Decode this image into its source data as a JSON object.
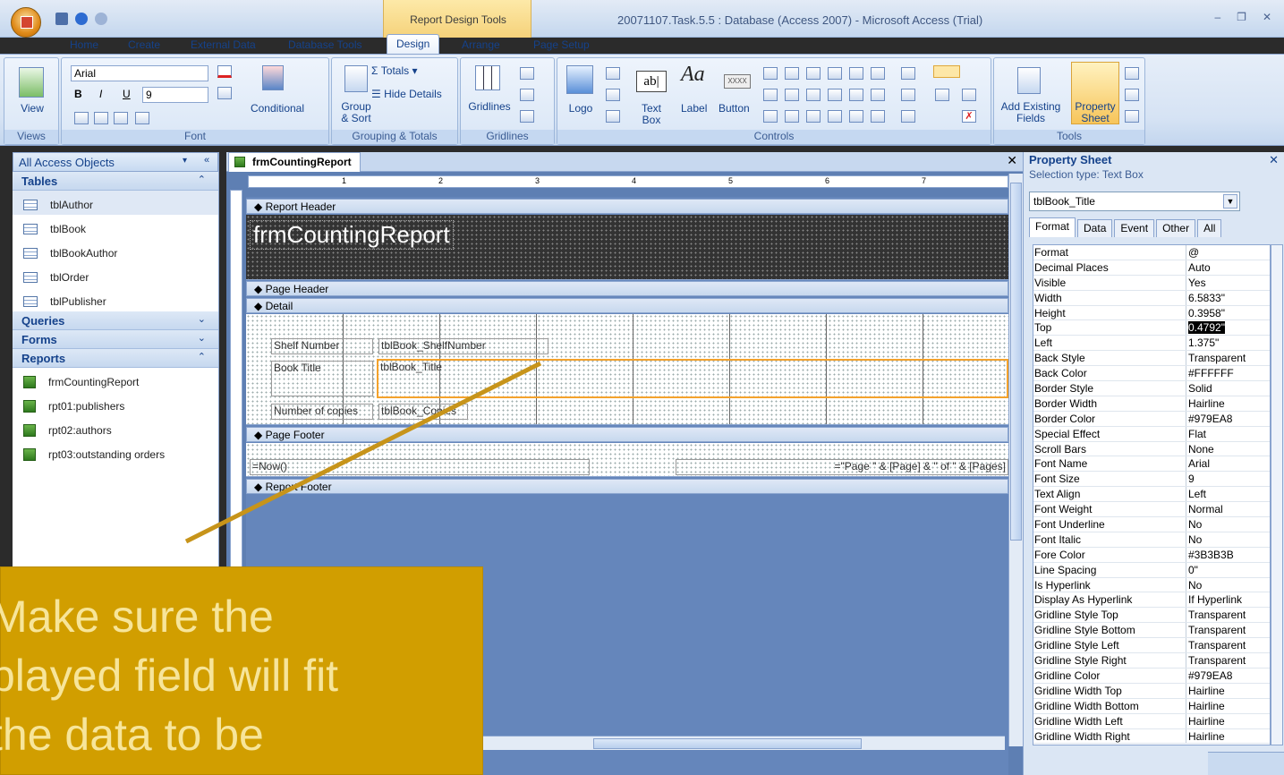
{
  "titlebar": {
    "context_label": "Report Design Tools",
    "window_title": "20071107.Task.5.5 : Database (Access 2007) - Microsoft Access (Trial)",
    "min": "–",
    "restore": "❐",
    "close": "✕"
  },
  "ribbon_tabs": [
    "Home",
    "Create",
    "External Data",
    "Database Tools",
    "Design",
    "Arrange",
    "Page Setup"
  ],
  "ribbon": {
    "views": {
      "view_label": "View",
      "group": "Views"
    },
    "font": {
      "font_name": "Arial",
      "font_size": "9",
      "conditional": "Conditional",
      "group": "Font",
      "bold": "B",
      "italic": "I",
      "underline": "U"
    },
    "grouping": {
      "totals": "Totals",
      "hide_details": "Hide Details",
      "group_sort": "Group\n& Sort",
      "group": "Grouping & Totals"
    },
    "gridlines": {
      "label": "Gridlines",
      "group": "Gridlines"
    },
    "controls": {
      "logo": "Logo",
      "text_box": "Text\nBox",
      "label": "Label",
      "button": "Button",
      "group": "Controls",
      "abl": "ab|",
      "aa": "Aa",
      "xxxx": "XXXX"
    },
    "tools": {
      "add_existing": "Add Existing\nFields",
      "property_sheet": "Property\nSheet",
      "group": "Tools"
    }
  },
  "nav": {
    "header": "All Access Objects",
    "categories": {
      "tables": "Tables",
      "queries": "Queries",
      "forms": "Forms",
      "reports": "Reports"
    },
    "tables": [
      "tblAuthor",
      "tblBook",
      "tblBookAuthor",
      "tblOrder",
      "tblPublisher"
    ],
    "reports": [
      "frmCountingReport",
      "rpt01:publishers",
      "rpt02:authors",
      "rpt03:outstanding orders"
    ]
  },
  "document": {
    "tab": "frmCountingReport",
    "close": "✕",
    "ruler_marks": [
      "1",
      "2",
      "3",
      "4",
      "5",
      "6",
      "7"
    ],
    "bands": {
      "report_header": "Report Header",
      "page_header": "Page Header",
      "detail": "Detail",
      "page_footer": "Page Footer",
      "report_footer": "Report Footer"
    },
    "header_title": "frmCountingReport",
    "controls": {
      "shelf_label": "Shelf Number",
      "shelf_field": "tblBook_ShelfNumber",
      "title_label": "Book Title",
      "title_field": "tblBook_Title",
      "copies_label": "Number of copies",
      "copies_field": "tblBook_Copies",
      "now_field": "=Now()",
      "page_field": "=\"Page \" & [Page] & \" of \" & [Pages]"
    }
  },
  "property_sheet": {
    "title": "Property Sheet",
    "close": "✕",
    "selection_type": "Selection type: Text Box",
    "selected_object": "tblBook_Title",
    "tabs": [
      "Format",
      "Data",
      "Event",
      "Other",
      "All"
    ],
    "active_tab": "Format",
    "rows": [
      {
        "k": "Format",
        "v": "@"
      },
      {
        "k": "Decimal Places",
        "v": "Auto"
      },
      {
        "k": "Visible",
        "v": "Yes"
      },
      {
        "k": "Width",
        "v": "6.5833\""
      },
      {
        "k": "Height",
        "v": "0.3958\""
      },
      {
        "k": "Top",
        "v": "0.4792\""
      },
      {
        "k": "Left",
        "v": "1.375\""
      },
      {
        "k": "Back Style",
        "v": "Transparent"
      },
      {
        "k": "Back Color",
        "v": "#FFFFFF"
      },
      {
        "k": "Border Style",
        "v": "Solid"
      },
      {
        "k": "Border Width",
        "v": "Hairline"
      },
      {
        "k": "Border Color",
        "v": "#979EA8"
      },
      {
        "k": "Special Effect",
        "v": "Flat"
      },
      {
        "k": "Scroll Bars",
        "v": "None"
      },
      {
        "k": "Font Name",
        "v": "Arial"
      },
      {
        "k": "Font Size",
        "v": "9"
      },
      {
        "k": "Text Align",
        "v": "Left"
      },
      {
        "k": "Font Weight",
        "v": "Normal"
      },
      {
        "k": "Font Underline",
        "v": "No"
      },
      {
        "k": "Font Italic",
        "v": "No"
      },
      {
        "k": "Fore Color",
        "v": "#3B3B3B"
      },
      {
        "k": "Line Spacing",
        "v": "0\""
      },
      {
        "k": "Is Hyperlink",
        "v": "No"
      },
      {
        "k": "Display As Hyperlink",
        "v": "If Hyperlink"
      },
      {
        "k": "Gridline Style Top",
        "v": "Transparent"
      },
      {
        "k": "Gridline Style Bottom",
        "v": "Transparent"
      },
      {
        "k": "Gridline Style Left",
        "v": "Transparent"
      },
      {
        "k": "Gridline Style Right",
        "v": "Transparent"
      },
      {
        "k": "Gridline Color",
        "v": "#979EA8"
      },
      {
        "k": "Gridline Width Top",
        "v": "Hairline"
      },
      {
        "k": "Gridline Width Bottom",
        "v": "Hairline"
      },
      {
        "k": "Gridline Width Left",
        "v": "Hairline"
      },
      {
        "k": "Gridline Width Right",
        "v": "Hairline"
      }
    ]
  },
  "callout": {
    "lines": [
      "Make sure the",
      "played field will fit",
      " the data to be"
    ]
  },
  "colors": {
    "callout": "#d19e00",
    "callout_text": "#f7e59a",
    "selection": "#f4a22c",
    "arrow": "#c7941a"
  }
}
